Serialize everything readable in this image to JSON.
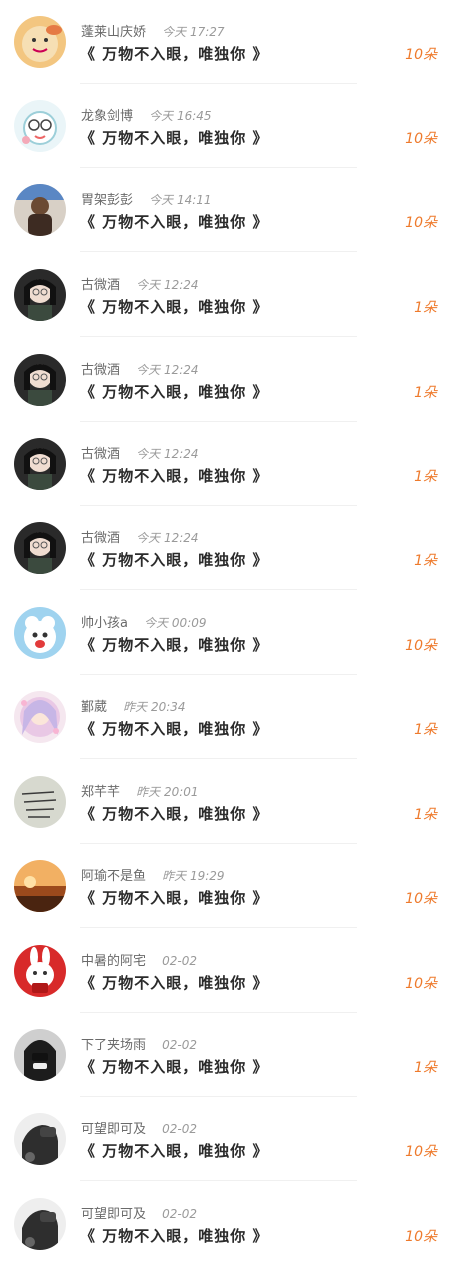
{
  "items": [
    {
      "name": "蓬莱山庆娇",
      "time": "今天 17:27",
      "title": "《 万物不入眼，唯独你 》",
      "count": "10朵",
      "avatar": "avatar-1"
    },
    {
      "name": "龙象剑博",
      "time": "今天 16:45",
      "title": "《 万物不入眼，唯独你 》",
      "count": "10朵",
      "avatar": "avatar-2"
    },
    {
      "name": "胃架彭彭",
      "time": "今天 14:11",
      "title": "《 万物不入眼，唯独你 》",
      "count": "10朵",
      "avatar": "avatar-3"
    },
    {
      "name": "古微酒",
      "time": "今天 12:24",
      "title": "《 万物不入眼，唯独你 》",
      "count": "1朵",
      "avatar": "avatar-4"
    },
    {
      "name": "古微酒",
      "time": "今天 12:24",
      "title": "《 万物不入眼，唯独你 》",
      "count": "1朵",
      "avatar": "avatar-4"
    },
    {
      "name": "古微酒",
      "time": "今天 12:24",
      "title": "《 万物不入眼，唯独你 》",
      "count": "1朵",
      "avatar": "avatar-4"
    },
    {
      "name": "古微酒",
      "time": "今天 12:24",
      "title": "《 万物不入眼，唯独你 》",
      "count": "1朵",
      "avatar": "avatar-4"
    },
    {
      "name": "帅小孩a",
      "time": "今天 00:09",
      "title": "《 万物不入眼，唯独你 》",
      "count": "10朵",
      "avatar": "avatar-5"
    },
    {
      "name": "鄞葳",
      "time": "昨天 20:34",
      "title": "《 万物不入眼，唯独你 》",
      "count": "1朵",
      "avatar": "avatar-6"
    },
    {
      "name": "郑芊芊",
      "time": "昨天 20:01",
      "title": "《 万物不入眼，唯独你 》",
      "count": "1朵",
      "avatar": "avatar-7"
    },
    {
      "name": "阿瑜不是鱼",
      "time": "昨天 19:29",
      "title": "《 万物不入眼，唯独你 》",
      "count": "10朵",
      "avatar": "avatar-8"
    },
    {
      "name": "中暑的阿宅",
      "time": "02-02",
      "title": "《 万物不入眼，唯独你 》",
      "count": "10朵",
      "avatar": "avatar-9"
    },
    {
      "name": "下了夹场雨",
      "time": "02-02",
      "title": "《 万物不入眼，唯独你 》",
      "count": "1朵",
      "avatar": "avatar-10"
    },
    {
      "name": "可望即可及",
      "time": "02-02",
      "title": "《 万物不入眼，唯独你 》",
      "count": "10朵",
      "avatar": "avatar-11"
    },
    {
      "name": "可望即可及",
      "time": "02-02",
      "title": "《 万物不入眼，唯独你 》",
      "count": "10朵",
      "avatar": "avatar-11"
    }
  ]
}
